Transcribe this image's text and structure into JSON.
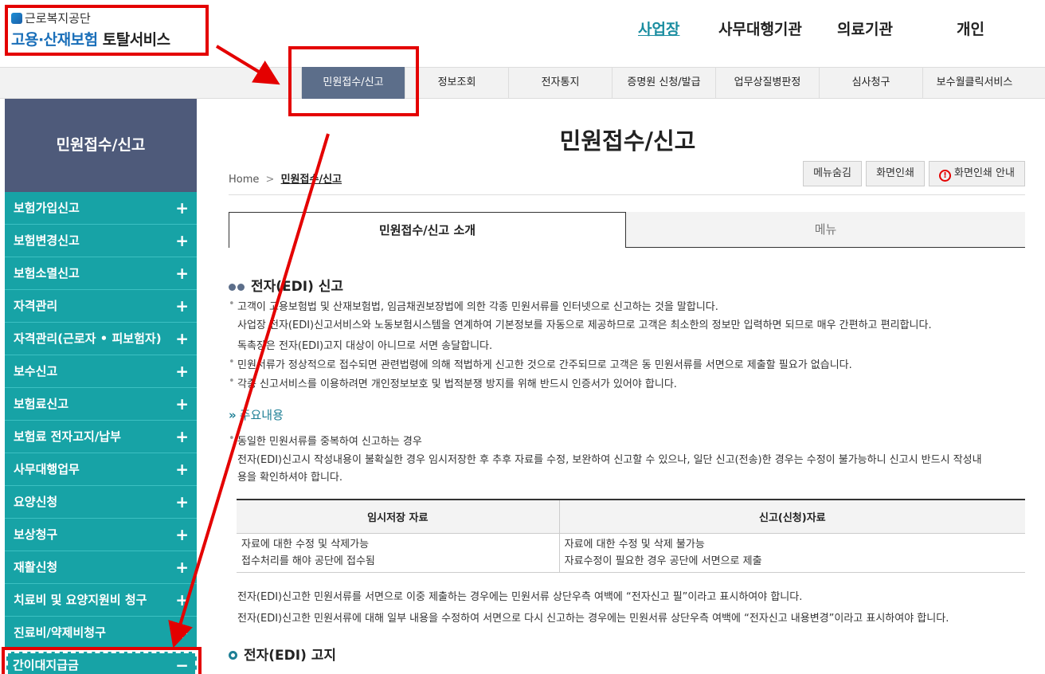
{
  "header": {
    "org_name": "근로복지공단",
    "service_prefix": "고용·산재보험",
    "service_suffix": "토탈서비스",
    "top_nav": [
      "사업장",
      "사무대행기관",
      "의료기관",
      "개인"
    ]
  },
  "gnb": [
    "민원접수/신고",
    "정보조회",
    "전자통지",
    "증명원 신청/발급",
    "업무상질병판정",
    "심사청구",
    "보수월클릭서비스"
  ],
  "sidebar": {
    "title": "민원접수/신고",
    "items": [
      "보험가입신고",
      "보험변경신고",
      "보험소멸신고",
      "자격관리",
      "자격관리(근로자 • 피보험자)",
      "보수신고",
      "보험료신고",
      "보험료 전자고지/납부",
      "사무대행업무",
      "요양신청",
      "보상청구",
      "재활신청",
      "치료비 및 요양지원비 청구",
      "진료비/약제비청구"
    ],
    "last_item": "간이대지급금",
    "plus": "+",
    "minus": "−"
  },
  "main": {
    "title": "민원접수/신고",
    "breadcrumb_home": "Home",
    "breadcrumb_sep": ">",
    "breadcrumb_current": "민원접수/신고",
    "buttons": [
      "메뉴숨김",
      "화면인쇄",
      "화면인쇄 안내"
    ],
    "tabs": [
      "민원접수/신고 소개",
      "메뉴"
    ],
    "section1_title": "전자(EDI) 신고",
    "section1_lines": [
      "고객이 고용보험법 및 산재보험법, 임금채권보장법에 의한 각종 민원서류를 인터넷으로 신고하는 것을 말합니다.",
      "사업장 전자(EDI)신고서비스와 노동보험시스템을 연계하여 기본정보를 자동으로 제공하므로 고객은 최소한의 정보만 입력하면 되므로 매우 간편하고 편리합니다.",
      "독촉장은 전자(EDI)고지 대상이 아니므로 서면 송달합니다.",
      "민원서류가 정상적으로 접수되면 관련법령에 의해 적법하게 신고한 것으로 간주되므로 고객은 동 민원서류를 서면으로 제출할 필요가 없습니다.",
      "각종 신고서비스를 이용하려면 개인정보보호 및 법적분쟁 방지를 위해 반드시 인증서가 있어야 합니다."
    ],
    "sub_title": "주요내용",
    "sub_lines": [
      "동일한 민원서류를 중복하여 신고하는 경우",
      "전자(EDI)신고시 작성내용이 불확실한 경우 임시저장한 후 추후 자료를 수정, 보완하여 신고할 수 있으나, 일단 신고(전송)한 경우는 수정이 불가능하니 신고시 반드시 작성내",
      "용을 확인하셔야 합니다."
    ],
    "table": {
      "headers": [
        "임시저장 자료",
        "신고(신청)자료"
      ],
      "col1": [
        "자료에 대한 수정 및 삭제가능",
        "접수처리를 해야 공단에 접수됨"
      ],
      "col2": [
        "자료에 대한 수정 및 삭제 불가능",
        "자료수정이 필요한 경우 공단에 서면으로 제출"
      ]
    },
    "notes": [
      "전자(EDI)신고한 민원서류를 서면으로 이중 제출하는 경우에는 민원서류 상단우측 여백에 “전자신고 필”이라고 표시하여야 합니다.",
      "전자(EDI)신고한 민원서류에 대해 일부 내용을 수정하여 서면으로 다시 신고하는 경우에는 민원서류 상단우측 여백에 “전자신고 내용변경”이라고 표시하여야 합니다."
    ],
    "section2_title": "전자(EDI) 고지"
  },
  "colors": {
    "sidebar_teal": "#17a3a6",
    "sidebar_head": "#4e5a7a",
    "gnb_active": "#5c6e8a",
    "annotation_red": "#e40000",
    "accent_teal": "#1a8da0"
  }
}
